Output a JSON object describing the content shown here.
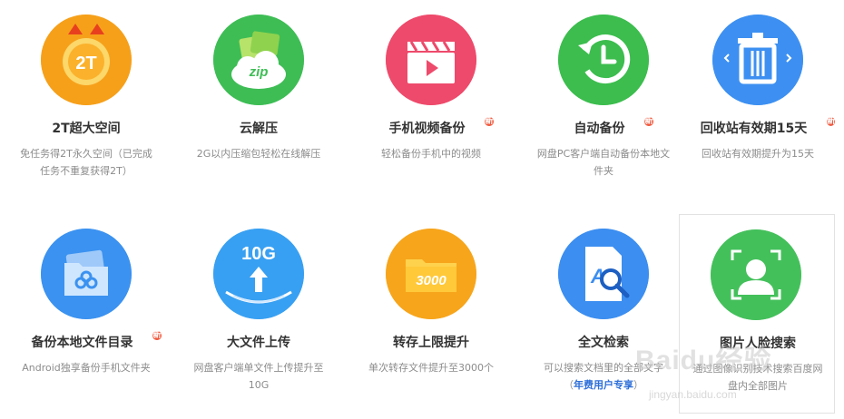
{
  "features": [
    {
      "title": "2T超大空间",
      "desc": "免任务得2T永久空间（已完成任务不重复获得2T）",
      "new": false,
      "icon": "2t-badge-icon",
      "color": "#f7a21b"
    },
    {
      "title": "云解压",
      "desc": "2G以内压缩包轻松在线解压",
      "new": false,
      "icon": "zip-cloud-icon",
      "color": "#43c15a"
    },
    {
      "title": "手机视频备份",
      "desc": "轻松备份手机中的视频",
      "new": true,
      "icon": "video-clapper-icon",
      "color": "#ef4a6a"
    },
    {
      "title": "自动备份",
      "desc": "网盘PC客户端自动备份本地文件夹",
      "new": true,
      "icon": "clock-backup-icon",
      "color": "#3fbf4f"
    },
    {
      "title": "回收站有效期15天",
      "desc": "回收站有效期提升为15天",
      "new": true,
      "icon": "trash-bin-icon",
      "color": "#3b8ff2"
    },
    {
      "title": "备份本地文件目录",
      "desc": "Android独享备份手机文件夹",
      "new": true,
      "icon": "folder-backup-icon",
      "color": "#3d93f0"
    },
    {
      "title": "大文件上传",
      "desc": "网盘客户端单文件上传提升至10G",
      "new": false,
      "icon": "upload-10g-icon",
      "color": "#3aa0f2"
    },
    {
      "title": "转存上限提升",
      "desc": "单次转存文件提升至3000个",
      "new": false,
      "icon": "folder-3000-icon",
      "color": "#f8a61c"
    },
    {
      "title": "全文检索",
      "desc_pre": "可以搜索文档里的全部文字（",
      "desc_vip": "年费用户专享",
      "desc_post": "）",
      "new": false,
      "icon": "doc-search-icon",
      "color": "#3c8ef0"
    },
    {
      "title": "图片人脸搜索",
      "desc": "通过图像识别技术搜索百度网盘内全部图片",
      "new": false,
      "icon": "face-scan-icon",
      "color": "#45c15c"
    }
  ],
  "new_badge_label": "新",
  "watermark": {
    "text": "Baidu经验",
    "sub": "jingyan.baidu.com"
  }
}
